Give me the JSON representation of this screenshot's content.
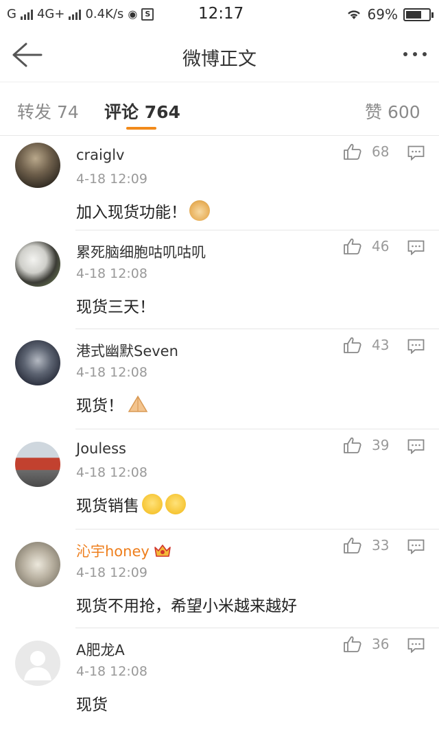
{
  "status": {
    "carrier1": "G",
    "carrier2": "4G+",
    "speed": "0.4K/s",
    "time": "12:17",
    "battery": "69%",
    "battery_level": 0.69
  },
  "nav": {
    "title": "微博正文"
  },
  "tabs": {
    "repost": "转发 74",
    "comment": "评论 764",
    "like": "赞 600"
  },
  "comments": [
    {
      "user": "craiglv",
      "time": "4-18 12:09",
      "text": "加入现货功能！",
      "likes": "68",
      "emoji": "doge-emoji"
    },
    {
      "user": "累死脑细胞咕叽咕叽",
      "time": "4-18 12:08",
      "text": "现货三天！",
      "likes": "46"
    },
    {
      "user": "港式幽默Seven",
      "time": "4-18 12:08",
      "text": "现货！",
      "likes": "43",
      "emoji": "pray-emoji"
    },
    {
      "user": "Jouless",
      "time": "4-18 12:08",
      "text": "现货销售",
      "likes": "39",
      "emoji": "shush-emoji"
    },
    {
      "user": "沁宇honey",
      "time": "4-18 12:09",
      "text": "现货不用抢，希望小米越来越好",
      "likes": "33",
      "vip": true
    },
    {
      "user": "A肥龙A",
      "time": "4-18 12:08",
      "text": "现货",
      "likes": "36"
    }
  ]
}
